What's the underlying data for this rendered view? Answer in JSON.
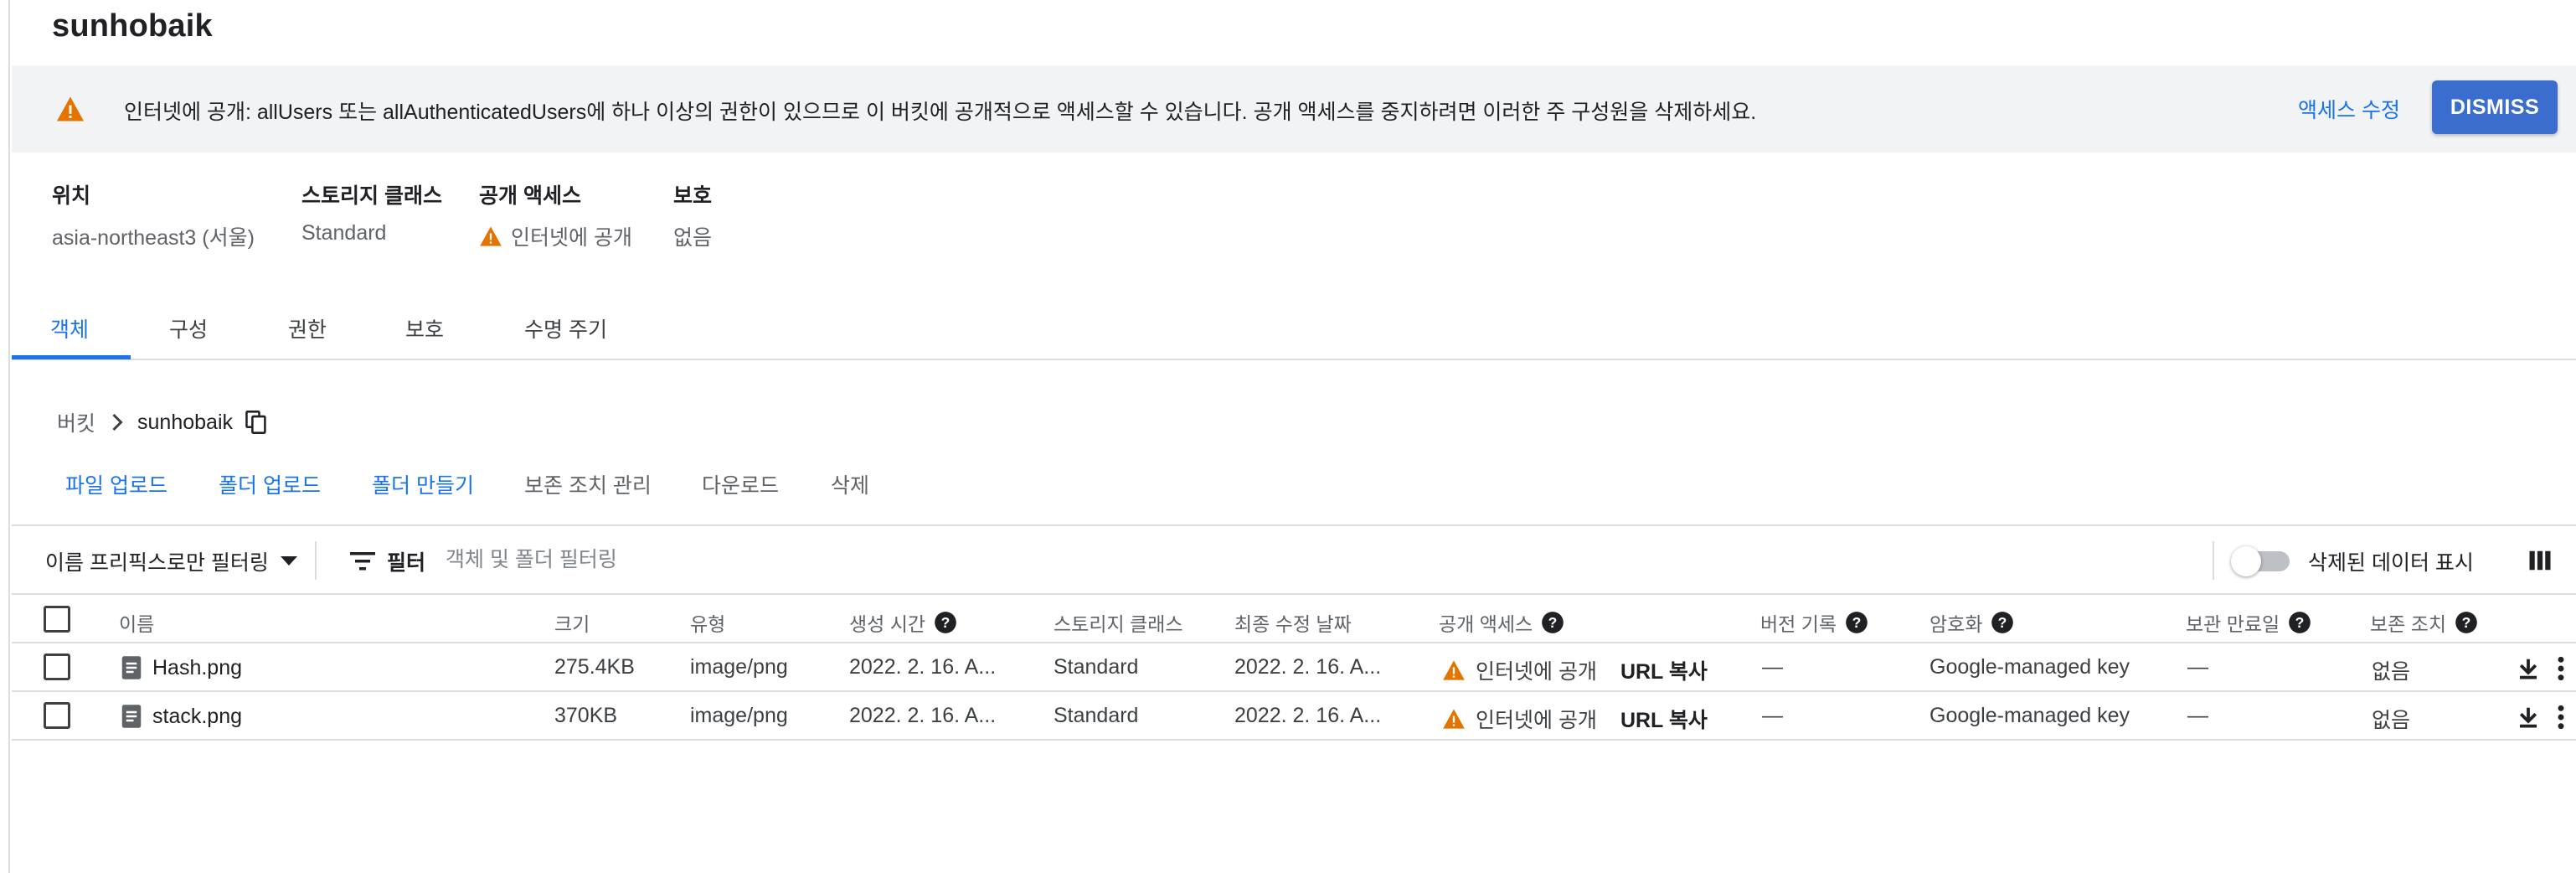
{
  "bucket": {
    "title": "sunhobaik"
  },
  "banner": {
    "icon": "warning-icon",
    "message": "인터넷에 공개: allUsers 또는 allAuthenticatedUsers에 하나 이상의 권한이 있으므로 이 버킷에 공개적으로 액세스할 수 있습니다. 공개 액세스를 중지하려면 이러한 주 구성원을 삭제하세요.",
    "edit_access_label": "액세스 수정",
    "dismiss_label": "DISMISS"
  },
  "info": {
    "location_label": "위치",
    "location_value": "asia-northeast3 (서울)",
    "storage_class_label": "스토리지 클래스",
    "storage_class_value": "Standard",
    "public_access_label": "공개 액세스",
    "public_access_value": "인터넷에 공개",
    "protection_label": "보호",
    "protection_value": "없음"
  },
  "tabs": [
    {
      "label": "객체",
      "active": true
    },
    {
      "label": "구성",
      "active": false
    },
    {
      "label": "권한",
      "active": false
    },
    {
      "label": "보호",
      "active": false
    },
    {
      "label": "수명 주기",
      "active": false
    }
  ],
  "breadcrumb": {
    "root": "버킷",
    "current": "sunhobaik"
  },
  "actions": {
    "upload_files": "파일 업로드",
    "upload_folder": "폴더 업로드",
    "create_folder": "폴더 만들기",
    "manage_holds": "보존 조치 관리",
    "download": "다운로드",
    "delete": "삭제"
  },
  "filterbar": {
    "prefix_filter_label": "이름 프리픽스로만 필터링",
    "filter_label": "필터",
    "filter_placeholder": "객체 및 폴더 필터링",
    "show_deleted_label": "삭제된 데이터 표시",
    "show_deleted_on": false
  },
  "table": {
    "columns": {
      "name": "이름",
      "size": "크기",
      "type": "유형",
      "created": "생성 시간",
      "storage_class": "스토리지 클래스",
      "last_modified": "최종 수정 날짜",
      "public_access": "공개 액세스",
      "version_history": "버전 기록",
      "encryption": "암호화",
      "retention_expiry": "보관 만료일",
      "holds": "보존 조치"
    },
    "rows": [
      {
        "name": "Hash.png",
        "size": "275.4KB",
        "type": "image/png",
        "created": "2022. 2. 16. A...",
        "storage_class": "Standard",
        "last_modified": "2022. 2. 16. A...",
        "public_access": "인터넷에 공개",
        "copy_url": "URL 복사",
        "version_history": "—",
        "encryption": "Google-managed key",
        "retention_expiry": "—",
        "holds": "없음"
      },
      {
        "name": "stack.png",
        "size": "370KB",
        "type": "image/png",
        "created": "2022. 2. 16. A...",
        "storage_class": "Standard",
        "last_modified": "2022. 2. 16. A...",
        "public_access": "인터넷에 공개",
        "copy_url": "URL 복사",
        "version_history": "—",
        "encryption": "Google-managed key",
        "retention_expiry": "—",
        "holds": "없음"
      }
    ]
  },
  "colors": {
    "accent": "#1a73e8",
    "warning": "#e37400",
    "dismiss_bg": "#3b6dcf"
  }
}
